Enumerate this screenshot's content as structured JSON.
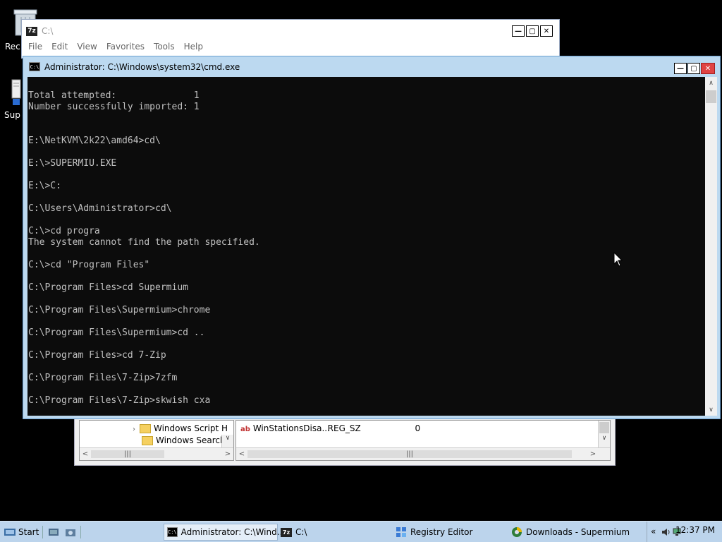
{
  "desktop": {
    "icons": [
      {
        "label": "Rec",
        "icon": "recycle-bin-icon"
      },
      {
        "label": "Sup",
        "icon": "shortcut-icon"
      }
    ]
  },
  "zip_window": {
    "title": "C:\\",
    "menu": [
      "File",
      "Edit",
      "View",
      "Favorites",
      "Tools",
      "Help"
    ]
  },
  "cmd_window": {
    "title": "Administrator: C:\\Windows\\system32\\cmd.exe",
    "lines": [
      "",
      "Total attempted:              1",
      "Number successfully imported: 1",
      "",
      "",
      "E:\\NetKVM\\2k22\\amd64>cd\\",
      "",
      "E:\\>SUPERMIU.EXE",
      "",
      "E:\\>C:",
      "",
      "C:\\Users\\Administrator>cd\\",
      "",
      "C:\\>cd progra",
      "The system cannot find the path specified.",
      "",
      "C:\\>cd \"Program Files\"",
      "",
      "C:\\Program Files>cd Supermium",
      "",
      "C:\\Program Files\\Supermium>chrome",
      "",
      "C:\\Program Files\\Supermium>cd ..",
      "",
      "C:\\Program Files>cd 7-Zip",
      "",
      "C:\\Program Files\\7-Zip>7zfm",
      "",
      "C:\\Program Files\\7-Zip>skwish cxa"
    ]
  },
  "registry_window": {
    "tree_items": [
      "Windows Script H",
      "Windows Search"
    ],
    "value_row": {
      "name": "WinStationsDisa...",
      "type": "REG_SZ",
      "data": "0"
    }
  },
  "taskbar": {
    "start_label": "Start",
    "items": [
      {
        "label": "Administrator: C:\\Wind...",
        "icon": "cmd-icon",
        "active": true
      },
      {
        "label": "C:\\",
        "icon": "7zip-icon",
        "active": false
      },
      {
        "label": "Registry Editor",
        "icon": "registry-editor-icon",
        "active": false
      },
      {
        "label": "Downloads - Supermium",
        "icon": "supermium-icon",
        "active": false
      }
    ],
    "clock": "12:37 PM",
    "tray_icons": [
      "show-hidden-icons-chevron",
      "volume-icon",
      "network-icon"
    ]
  }
}
